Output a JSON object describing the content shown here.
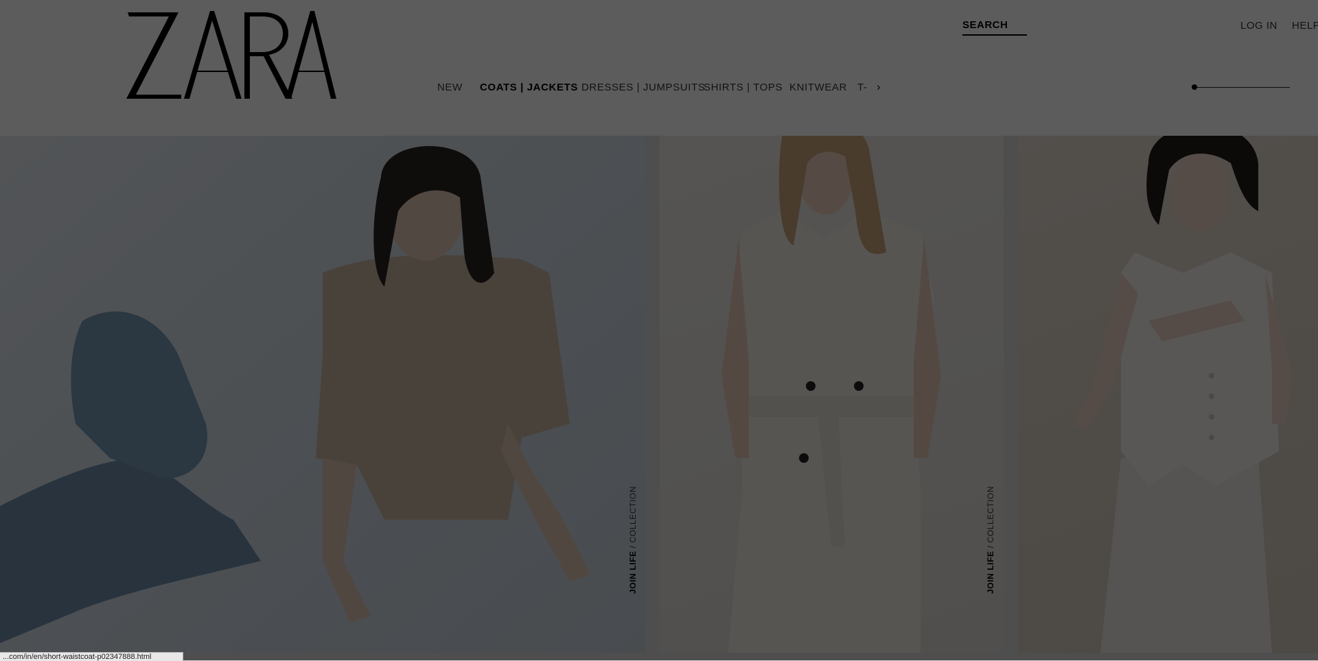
{
  "header": {
    "logo_text": "ZARA",
    "search_label": "SEARCH",
    "login_label": "LOG IN",
    "help_label": "HELP"
  },
  "nav": {
    "items": [
      "NEW",
      "COATS | JACKETS",
      "DRESSES | JUMPSUITS",
      "SHIRTS | TOPS",
      "KNITWEAR",
      "T-"
    ],
    "active": "COATS | JACKETS",
    "next_arrow": "›"
  },
  "slider": {
    "position": 0
  },
  "products": [
    {
      "label_strong": "JOIN LIFE",
      "label_rest": " / COLLECTION",
      "description": "model in beige short-sleeve jacket and blue jeans"
    },
    {
      "label_strong": "JOIN LIFE",
      "label_rest": " / COLLECTION",
      "description": "model in sleeveless belted trench dress"
    },
    {
      "description": "model in white waistcoat and trousers"
    }
  ],
  "status_url": "...com/in/en/short-waistcoat-p02347888.html",
  "colors": {
    "overlay": "#000000",
    "text": "#333333",
    "accent": "#000000"
  }
}
